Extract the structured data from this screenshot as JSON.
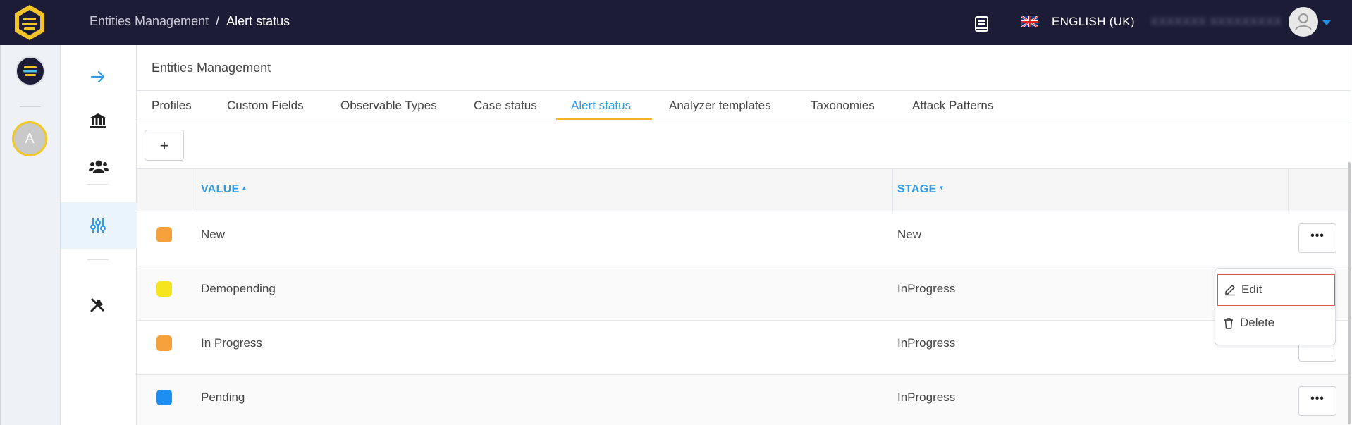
{
  "topbar": {
    "breadcrumb_parent": "Entities Management",
    "breadcrumb_separator": "/",
    "breadcrumb_current": "Alert status",
    "language": "ENGLISH (UK)",
    "username_blurred": "XXXXXXX XXXXXXXXX"
  },
  "rail": {
    "avatar_letter": "A"
  },
  "page": {
    "title": "Entities Management",
    "tabs": [
      {
        "label": "Profiles"
      },
      {
        "label": "Custom Fields"
      },
      {
        "label": "Observable Types"
      },
      {
        "label": "Case status"
      },
      {
        "label": "Alert status",
        "active": true
      },
      {
        "label": "Analyzer templates"
      },
      {
        "label": "Taxonomies"
      },
      {
        "label": "Attack Patterns"
      }
    ],
    "add_button_label": "+"
  },
  "table": {
    "columns": {
      "value": "VALUE",
      "stage": "STAGE"
    },
    "rows": [
      {
        "color": "#f7a13c",
        "value": "New",
        "stage": "New"
      },
      {
        "color": "#f5e51e",
        "value": "Demopending",
        "stage": "InProgress"
      },
      {
        "color": "#f7a13c",
        "value": "In Progress",
        "stage": "InProgress"
      },
      {
        "color": "#1f8ef1",
        "value": "Pending",
        "stage": "InProgress"
      }
    ],
    "more_label": "•••"
  },
  "context_menu": {
    "edit_label": "Edit",
    "delete_label": "Delete"
  }
}
